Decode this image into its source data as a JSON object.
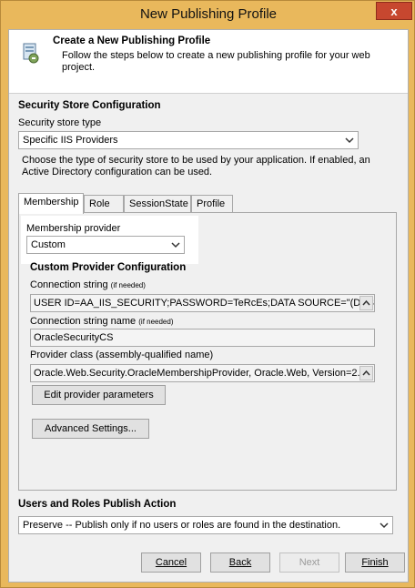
{
  "window": {
    "title": "New Publishing Profile",
    "close_glyph": "x"
  },
  "header": {
    "title": "Create a New Publishing Profile",
    "description": "Follow the steps below to create a new publishing profile for your web project.",
    "icon": "profile-wizard-icon"
  },
  "security": {
    "section_title": "Security Store Configuration",
    "store_type_label": "Security store type",
    "store_type_value": "Specific IIS Providers",
    "description": "Choose the type of security store to be used by your application. If enabled, an Active Directory configuration can be used."
  },
  "tabs": [
    {
      "label": "Membership",
      "active": true
    },
    {
      "label": "Role",
      "active": false
    },
    {
      "label": "SessionState",
      "active": false
    },
    {
      "label": "Profile",
      "active": false
    }
  ],
  "membership": {
    "provider_label": "Membership provider",
    "provider_value": "Custom",
    "custom_section_title": "Custom Provider Configuration",
    "connection_string_label": "Connection string",
    "connection_string_note": "(if needed)",
    "connection_string_value": "USER ID=AA_IIS_SECURITY;PASSWORD=TeRcEs;DATA SOURCE=\"(DESC",
    "connection_string_name_label": "Connection string name",
    "connection_string_name_note": "(if needed)",
    "connection_string_name_value": "OracleSecurityCS",
    "provider_class_label": "Provider class (assembly-qualified name)",
    "provider_class_value": "Oracle.Web.Security.OracleMembershipProvider, Oracle.Web, Version=2.",
    "edit_params_button": "Edit provider parameters",
    "advanced_button": "Advanced Settings..."
  },
  "users_roles": {
    "section_title": "Users and Roles Publish Action",
    "action_value": "Preserve -- Publish only if no users or roles are found in the destination."
  },
  "footer": {
    "cancel": "Cancel",
    "back": "Back",
    "next": "Next",
    "finish": "Finish"
  },
  "colors": {
    "window_frame": "#e9b85c",
    "close_button": "#c7472f"
  }
}
